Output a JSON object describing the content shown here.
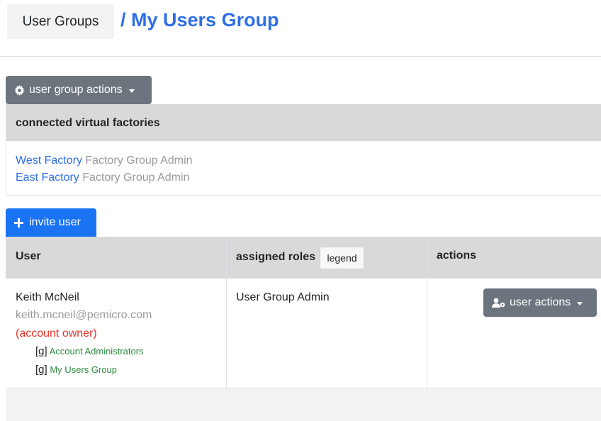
{
  "breadcrumb": {
    "home": "User Groups",
    "current": "/ My Users Group"
  },
  "group_actions": {
    "label": "user group actions",
    "icon": "gear-icon"
  },
  "virtual_factories": {
    "heading": "connected virtual factories",
    "items": [
      {
        "name": "West Factory",
        "role": "Factory Group Admin"
      },
      {
        "name": "East Factory",
        "role": "Factory Group Admin"
      }
    ]
  },
  "invite": {
    "label": "invite user",
    "icon": "plus-icon"
  },
  "table": {
    "headers": {
      "user": "User",
      "roles": "assigned roles",
      "legend": "legend",
      "actions": "actions"
    },
    "rows": [
      {
        "name": "Keith McNeil",
        "email": "keith.mcneil@pemicro.com",
        "owner_note": "(account owner)",
        "groups": [
          {
            "tag": "[g]",
            "name": "Account Administrators"
          },
          {
            "tag": "[g]",
            "name": "My Users Group"
          }
        ],
        "role": "User Group Admin",
        "action_label": "user actions",
        "action_icon": "user-gear-icon"
      }
    ]
  },
  "colors": {
    "link": "#2f6fe6",
    "primary": "#1a73f2",
    "secondary": "#6c757d",
    "owner": "#e5332a",
    "group": "#2b8a3e"
  }
}
